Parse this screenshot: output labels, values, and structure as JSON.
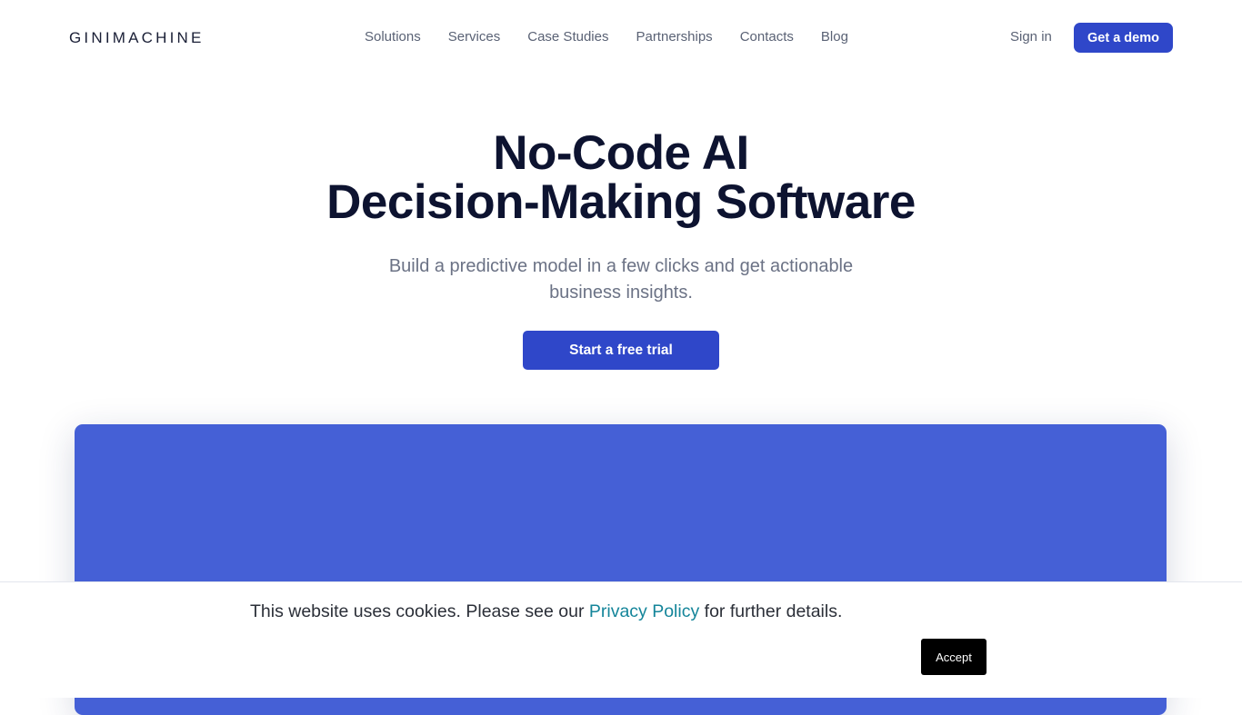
{
  "brand": {
    "logo": "GINIMACHINE"
  },
  "nav": {
    "items": [
      "Solutions",
      "Services",
      "Case Studies",
      "Partnerships",
      "Contacts",
      "Blog"
    ],
    "sign_in": "Sign in",
    "demo": "Get a demo"
  },
  "hero": {
    "title_line1": "No-Code AI",
    "title_line2": "Decision-Making Software",
    "subtitle": "Build a predictive model in a few clicks and get actionable business insights.",
    "cta": "Start a free trial"
  },
  "cookie": {
    "text_before": "This website uses cookies. Please see our ",
    "link": "Privacy Policy",
    "text_after": " for further details.",
    "accept": "Accept"
  },
  "colors": {
    "accent": "#2f47c9",
    "panel": "#4560d6",
    "link": "#14859a"
  }
}
